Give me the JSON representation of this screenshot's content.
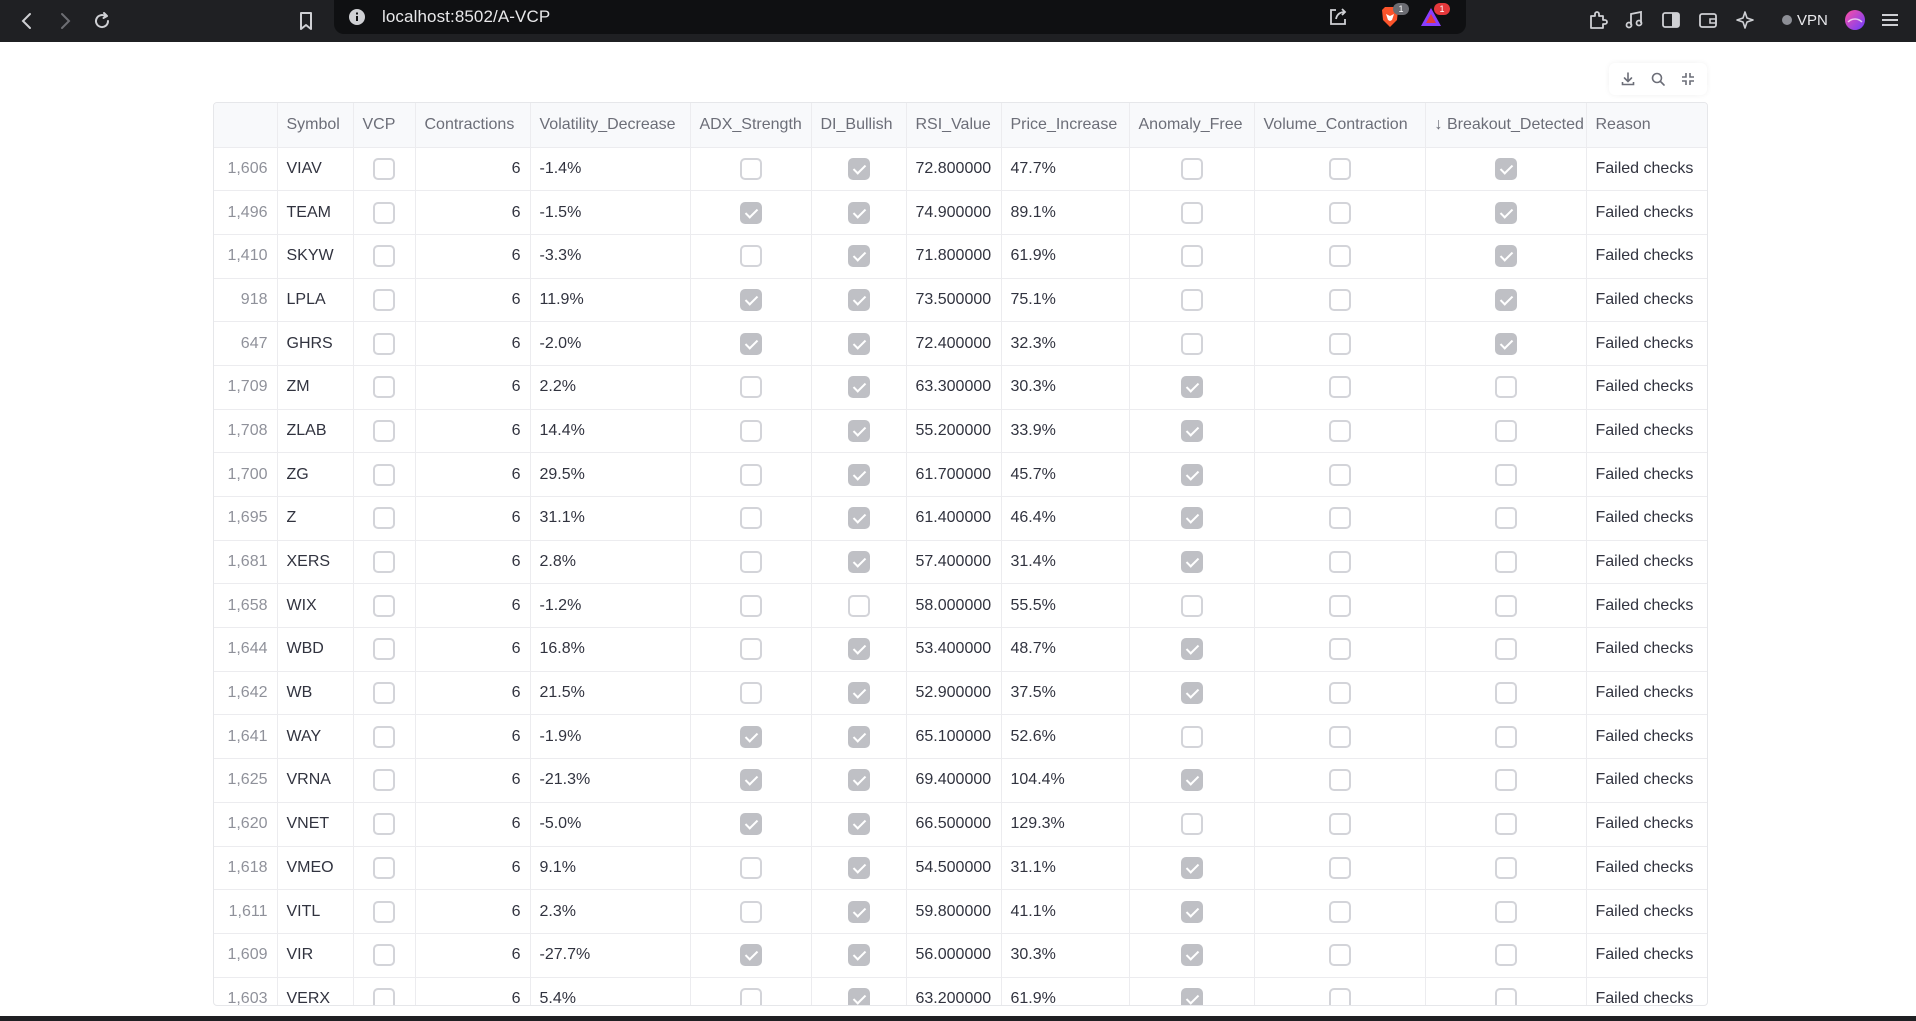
{
  "browser": {
    "url": "localhost:8502/A-VCP",
    "brave_badge": "1",
    "rewards_badge": "1",
    "vpn_label": "VPN"
  },
  "colors": {
    "chrome_bg": "#1f2023",
    "url_bg": "#0f1012",
    "checked_fill": "#bfc0c5",
    "brave_orange": "#fb542b",
    "rewards_red": "#e5383b"
  },
  "table": {
    "columns": [
      "",
      "Symbol",
      "VCP",
      "Contractions",
      "Volatility_Decrease",
      "ADX_Strength",
      "DI_Bullish",
      "RSI_Value",
      "Price_Increase",
      "Anomaly_Free",
      "Volume_Contraction",
      "↓ Breakout_Detected",
      "Reason"
    ],
    "rows": [
      {
        "idx": "1,606",
        "symbol": "VIAV",
        "vcp": false,
        "contractions": "6",
        "vol_dec": "-1.4%",
        "adx": false,
        "di": true,
        "rsi": "72.800000",
        "price": "47.7%",
        "anomaly": false,
        "volume": false,
        "breakout": true,
        "reason": "Failed checks"
      },
      {
        "idx": "1,496",
        "symbol": "TEAM",
        "vcp": false,
        "contractions": "6",
        "vol_dec": "-1.5%",
        "adx": true,
        "di": true,
        "rsi": "74.900000",
        "price": "89.1%",
        "anomaly": false,
        "volume": false,
        "breakout": true,
        "reason": "Failed checks"
      },
      {
        "idx": "1,410",
        "symbol": "SKYW",
        "vcp": false,
        "contractions": "6",
        "vol_dec": "-3.3%",
        "adx": false,
        "di": true,
        "rsi": "71.800000",
        "price": "61.9%",
        "anomaly": false,
        "volume": false,
        "breakout": true,
        "reason": "Failed checks"
      },
      {
        "idx": "918",
        "symbol": "LPLA",
        "vcp": false,
        "contractions": "6",
        "vol_dec": "11.9%",
        "adx": true,
        "di": true,
        "rsi": "73.500000",
        "price": "75.1%",
        "anomaly": false,
        "volume": false,
        "breakout": true,
        "reason": "Failed checks"
      },
      {
        "idx": "647",
        "symbol": "GHRS",
        "vcp": false,
        "contractions": "6",
        "vol_dec": "-2.0%",
        "adx": true,
        "di": true,
        "rsi": "72.400000",
        "price": "32.3%",
        "anomaly": false,
        "volume": false,
        "breakout": true,
        "reason": "Failed checks"
      },
      {
        "idx": "1,709",
        "symbol": "ZM",
        "vcp": false,
        "contractions": "6",
        "vol_dec": "2.2%",
        "adx": false,
        "di": true,
        "rsi": "63.300000",
        "price": "30.3%",
        "anomaly": true,
        "volume": false,
        "breakout": false,
        "reason": "Failed checks"
      },
      {
        "idx": "1,708",
        "symbol": "ZLAB",
        "vcp": false,
        "contractions": "6",
        "vol_dec": "14.4%",
        "adx": false,
        "di": true,
        "rsi": "55.200000",
        "price": "33.9%",
        "anomaly": true,
        "volume": false,
        "breakout": false,
        "reason": "Failed checks"
      },
      {
        "idx": "1,700",
        "symbol": "ZG",
        "vcp": false,
        "contractions": "6",
        "vol_dec": "29.5%",
        "adx": false,
        "di": true,
        "rsi": "61.700000",
        "price": "45.7%",
        "anomaly": true,
        "volume": false,
        "breakout": false,
        "reason": "Failed checks"
      },
      {
        "idx": "1,695",
        "symbol": "Z",
        "vcp": false,
        "contractions": "6",
        "vol_dec": "31.1%",
        "adx": false,
        "di": true,
        "rsi": "61.400000",
        "price": "46.4%",
        "anomaly": true,
        "volume": false,
        "breakout": false,
        "reason": "Failed checks"
      },
      {
        "idx": "1,681",
        "symbol": "XERS",
        "vcp": false,
        "contractions": "6",
        "vol_dec": "2.8%",
        "adx": false,
        "di": true,
        "rsi": "57.400000",
        "price": "31.4%",
        "anomaly": true,
        "volume": false,
        "breakout": false,
        "reason": "Failed checks"
      },
      {
        "idx": "1,658",
        "symbol": "WIX",
        "vcp": false,
        "contractions": "6",
        "vol_dec": "-1.2%",
        "adx": false,
        "di": false,
        "rsi": "58.000000",
        "price": "55.5%",
        "anomaly": false,
        "volume": false,
        "breakout": false,
        "reason": "Failed checks"
      },
      {
        "idx": "1,644",
        "symbol": "WBD",
        "vcp": false,
        "contractions": "6",
        "vol_dec": "16.8%",
        "adx": false,
        "di": true,
        "rsi": "53.400000",
        "price": "48.7%",
        "anomaly": true,
        "volume": false,
        "breakout": false,
        "reason": "Failed checks"
      },
      {
        "idx": "1,642",
        "symbol": "WB",
        "vcp": false,
        "contractions": "6",
        "vol_dec": "21.5%",
        "adx": false,
        "di": true,
        "rsi": "52.900000",
        "price": "37.5%",
        "anomaly": true,
        "volume": false,
        "breakout": false,
        "reason": "Failed checks"
      },
      {
        "idx": "1,641",
        "symbol": "WAY",
        "vcp": false,
        "contractions": "6",
        "vol_dec": "-1.9%",
        "adx": true,
        "di": true,
        "rsi": "65.100000",
        "price": "52.6%",
        "anomaly": false,
        "volume": false,
        "breakout": false,
        "reason": "Failed checks"
      },
      {
        "idx": "1,625",
        "symbol": "VRNA",
        "vcp": false,
        "contractions": "6",
        "vol_dec": "-21.3%",
        "adx": true,
        "di": true,
        "rsi": "69.400000",
        "price": "104.4%",
        "anomaly": true,
        "volume": false,
        "breakout": false,
        "reason": "Failed checks"
      },
      {
        "idx": "1,620",
        "symbol": "VNET",
        "vcp": false,
        "contractions": "6",
        "vol_dec": "-5.0%",
        "adx": true,
        "di": true,
        "rsi": "66.500000",
        "price": "129.3%",
        "anomaly": false,
        "volume": false,
        "breakout": false,
        "reason": "Failed checks"
      },
      {
        "idx": "1,618",
        "symbol": "VMEO",
        "vcp": false,
        "contractions": "6",
        "vol_dec": "9.1%",
        "adx": false,
        "di": true,
        "rsi": "54.500000",
        "price": "31.1%",
        "anomaly": true,
        "volume": false,
        "breakout": false,
        "reason": "Failed checks"
      },
      {
        "idx": "1,611",
        "symbol": "VITL",
        "vcp": false,
        "contractions": "6",
        "vol_dec": "2.3%",
        "adx": false,
        "di": true,
        "rsi": "59.800000",
        "price": "41.1%",
        "anomaly": true,
        "volume": false,
        "breakout": false,
        "reason": "Failed checks"
      },
      {
        "idx": "1,609",
        "symbol": "VIR",
        "vcp": false,
        "contractions": "6",
        "vol_dec": "-27.7%",
        "adx": true,
        "di": true,
        "rsi": "56.000000",
        "price": "30.3%",
        "anomaly": true,
        "volume": false,
        "breakout": false,
        "reason": "Failed checks"
      },
      {
        "idx": "1,603",
        "symbol": "VERX",
        "vcp": false,
        "contractions": "6",
        "vol_dec": "5.4%",
        "adx": false,
        "di": true,
        "rsi": "63.200000",
        "price": "61.9%",
        "anomaly": true,
        "volume": false,
        "breakout": false,
        "reason": "Failed checks"
      }
    ]
  },
  "icons": {
    "back": "chevron-left-icon",
    "forward": "chevron-right-icon",
    "reload": "reload-icon",
    "bookmark": "bookmark-icon",
    "site_info": "info-icon",
    "share": "share-icon",
    "brave": "brave-lion-icon",
    "rewards": "rewards-triangle-icon",
    "extensions": "puzzle-icon",
    "media": "music-note-icon",
    "sidebar": "sidebar-icon",
    "wallet": "wallet-icon",
    "leo": "sparkle-icon",
    "profile": "profile-avatar-icon",
    "menu": "hamburger-menu-icon",
    "download": "download-icon",
    "search": "search-icon",
    "fullscreen": "fullscreen-icon"
  }
}
